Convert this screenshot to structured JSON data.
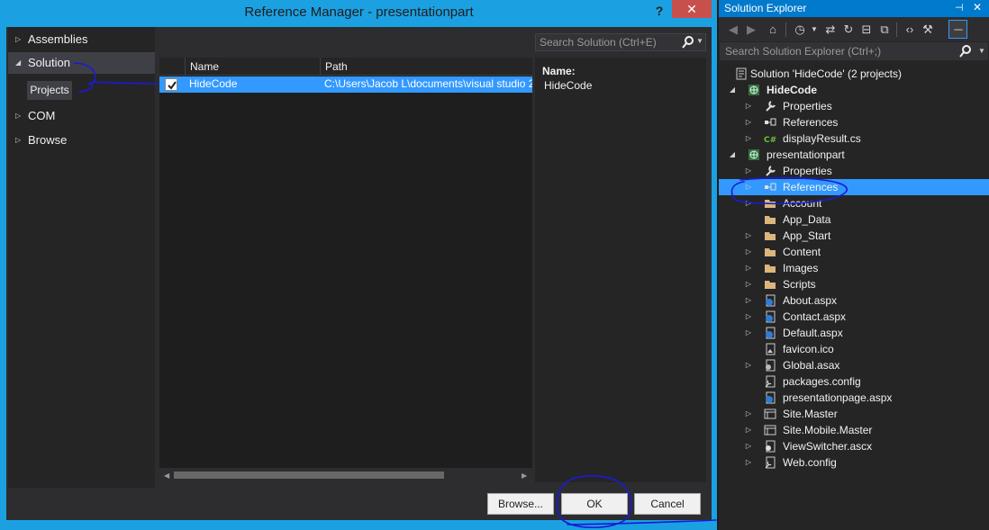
{
  "dialog": {
    "title": "Reference Manager - presentationpart",
    "help_label": "?",
    "close_label": "✕",
    "nav": [
      {
        "label": "Assemblies",
        "expanded": false
      },
      {
        "label": "Solution",
        "expanded": true,
        "selected": true
      },
      {
        "label": "COM",
        "expanded": false
      },
      {
        "label": "Browse",
        "expanded": false
      }
    ],
    "nav_sub_projects": "Projects",
    "search_placeholder": "Search Solution (Ctrl+E)",
    "grid": {
      "col_name": "Name",
      "col_path": "Path",
      "rows": [
        {
          "checked": true,
          "name": "HideCode",
          "path": "C:\\Users\\Jacob L\\documents\\visual studio 2"
        }
      ]
    },
    "detail": {
      "name_label": "Name:",
      "name_value": "HideCode"
    },
    "buttons": {
      "browse": "Browse...",
      "ok": "OK",
      "cancel": "Cancel"
    }
  },
  "solution_explorer": {
    "title": "Solution Explorer",
    "pin_label": "⊣",
    "close_label": "✕",
    "search_placeholder": "Search Solution Explorer (Ctrl+;)",
    "tree": [
      {
        "label": "Solution 'HideCode' (2 projects)",
        "icon": "solution-icon",
        "level": 0,
        "expander": "none"
      },
      {
        "label": "HideCode",
        "icon": "web-project-icon",
        "level": 0,
        "expander": "expanded",
        "bold": true
      },
      {
        "label": "Properties",
        "icon": "wrench-icon",
        "level": 1,
        "expander": "collapsed"
      },
      {
        "label": "References",
        "icon": "references-icon",
        "level": 1,
        "expander": "collapsed"
      },
      {
        "label": "displayResult.cs",
        "icon": "csharp-file-icon",
        "level": 1,
        "expander": "collapsed"
      },
      {
        "label": "presentationpart",
        "icon": "web-project-icon",
        "level": 0,
        "expander": "expanded"
      },
      {
        "label": "Properties",
        "icon": "wrench-icon",
        "level": 1,
        "expander": "collapsed"
      },
      {
        "label": "References",
        "icon": "references-icon",
        "level": 1,
        "expander": "collapsed",
        "selected": true
      },
      {
        "label": "Account",
        "icon": "folder-icon",
        "level": 1,
        "expander": "collapsed"
      },
      {
        "label": "App_Data",
        "icon": "folder-icon",
        "level": 1,
        "expander": "none"
      },
      {
        "label": "App_Start",
        "icon": "folder-icon",
        "level": 1,
        "expander": "collapsed"
      },
      {
        "label": "Content",
        "icon": "folder-icon",
        "level": 1,
        "expander": "collapsed"
      },
      {
        "label": "Images",
        "icon": "folder-icon",
        "level": 1,
        "expander": "collapsed"
      },
      {
        "label": "Scripts",
        "icon": "folder-icon",
        "level": 1,
        "expander": "collapsed"
      },
      {
        "label": "About.aspx",
        "icon": "aspx-file-icon",
        "level": 1,
        "expander": "collapsed"
      },
      {
        "label": "Contact.aspx",
        "icon": "aspx-file-icon",
        "level": 1,
        "expander": "collapsed"
      },
      {
        "label": "Default.aspx",
        "icon": "aspx-file-icon",
        "level": 1,
        "expander": "collapsed"
      },
      {
        "label": "favicon.ico",
        "icon": "image-file-icon",
        "level": 1,
        "expander": "none"
      },
      {
        "label": "Global.asax",
        "icon": "asax-file-icon",
        "level": 1,
        "expander": "collapsed"
      },
      {
        "label": "packages.config",
        "icon": "config-file-icon",
        "level": 1,
        "expander": "none"
      },
      {
        "label": "presentationpage.aspx",
        "icon": "aspx-file-icon",
        "level": 1,
        "expander": "none"
      },
      {
        "label": "Site.Master",
        "icon": "master-file-icon",
        "level": 1,
        "expander": "collapsed"
      },
      {
        "label": "Site.Mobile.Master",
        "icon": "master-file-icon",
        "level": 1,
        "expander": "collapsed"
      },
      {
        "label": "ViewSwitcher.ascx",
        "icon": "ascx-file-icon",
        "level": 1,
        "expander": "collapsed"
      },
      {
        "label": "Web.config",
        "icon": "config-file-icon",
        "level": 1,
        "expander": "collapsed"
      }
    ]
  },
  "colors": {
    "accent": "#1ba1e2",
    "selection": "#3399ff",
    "ink": "#0000cc",
    "folder": "#dcb67a"
  }
}
